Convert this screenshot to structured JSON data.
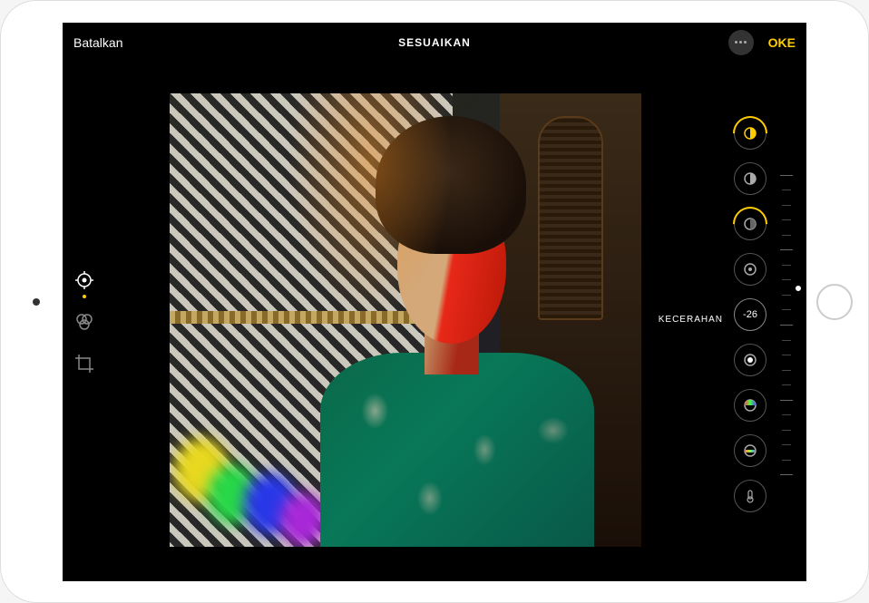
{
  "header": {
    "cancel_label": "Batalkan",
    "title": "SESUAIKAN",
    "done_label": "OKE"
  },
  "left_tools": {
    "adjust": "adjust-icon",
    "filters": "filters-icon",
    "crop": "crop-icon"
  },
  "active_adjustment": {
    "label": "KECERAHAN",
    "value": "-26"
  },
  "adjustments": [
    {
      "name": "auto",
      "icon": "auto-icon"
    },
    {
      "name": "exposure",
      "icon": "exposure-icon"
    },
    {
      "name": "brilliance",
      "icon": "brilliance-icon"
    },
    {
      "name": "highlights",
      "icon": "highlights-icon"
    },
    {
      "name": "brightness",
      "icon": "brightness-icon",
      "selected": true
    },
    {
      "name": "contrast",
      "icon": "contrast-icon"
    },
    {
      "name": "saturation",
      "icon": "saturation-icon"
    },
    {
      "name": "vibrance",
      "icon": "vibrance-icon"
    },
    {
      "name": "warmth",
      "icon": "warmth-icon"
    }
  ],
  "colors": {
    "accent": "#ffcc00",
    "background": "#000000"
  }
}
